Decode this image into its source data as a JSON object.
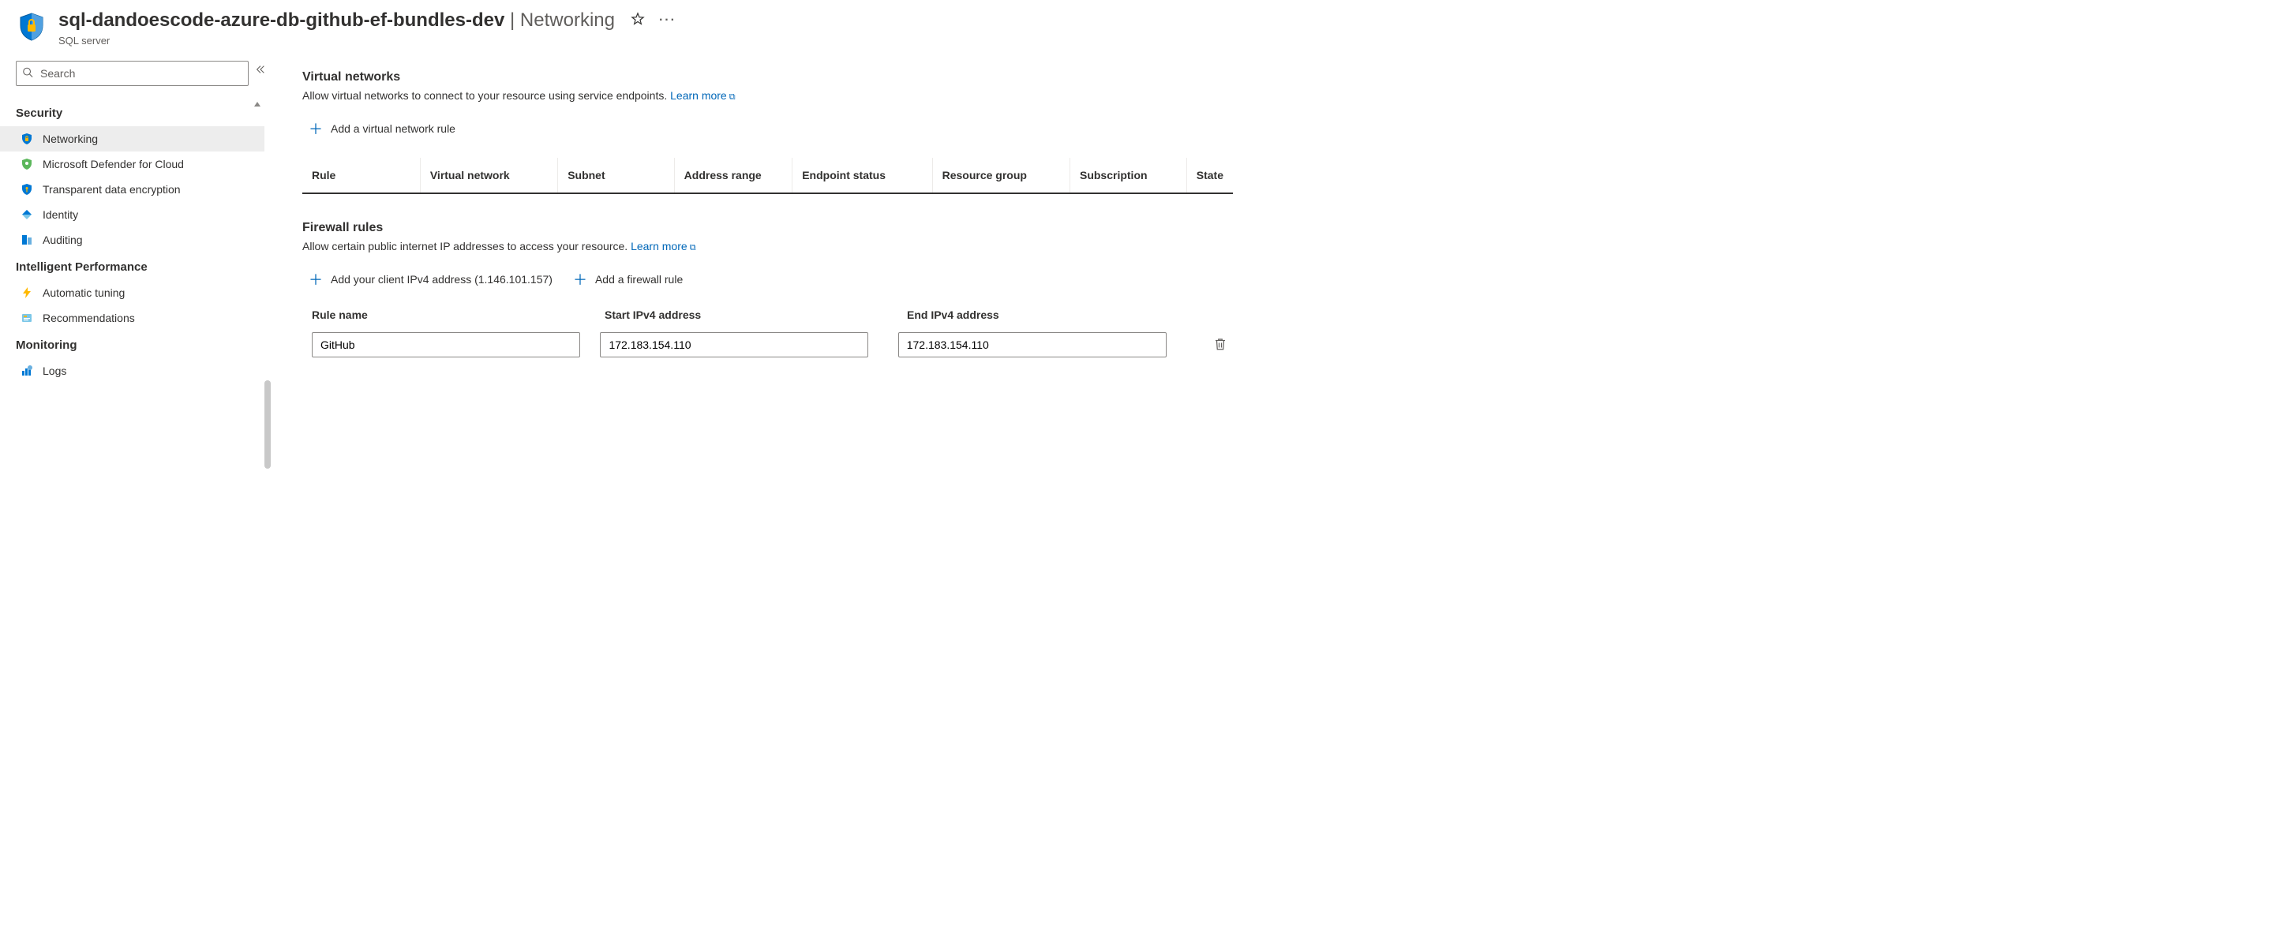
{
  "header": {
    "title": "sql-dandoescode-azure-db-github-ef-bundles-dev",
    "section": "Networking",
    "resource_type": "SQL server"
  },
  "sidebar": {
    "search_placeholder": "Search",
    "groups": [
      {
        "title": "Security",
        "items": [
          {
            "label": "Networking",
            "icon": "shield-lock-icon",
            "selected": true
          },
          {
            "label": "Microsoft Defender for Cloud",
            "icon": "defender-icon",
            "selected": false
          },
          {
            "label": "Transparent data encryption",
            "icon": "shield-key-icon",
            "selected": false
          },
          {
            "label": "Identity",
            "icon": "identity-icon",
            "selected": false
          },
          {
            "label": "Auditing",
            "icon": "auditing-icon",
            "selected": false
          }
        ]
      },
      {
        "title": "Intelligent Performance",
        "items": [
          {
            "label": "Automatic tuning",
            "icon": "lightning-icon",
            "selected": false
          },
          {
            "label": "Recommendations",
            "icon": "recommendations-icon",
            "selected": false
          }
        ]
      },
      {
        "title": "Monitoring",
        "items": [
          {
            "label": "Logs",
            "icon": "logs-icon",
            "selected": false
          }
        ]
      }
    ]
  },
  "main": {
    "vnet": {
      "title": "Virtual networks",
      "desc": "Allow virtual networks to connect to your resource using service endpoints.",
      "learn_more": "Learn more",
      "add_label": "Add a virtual network rule",
      "columns": [
        "Rule",
        "Virtual network",
        "Subnet",
        "Address range",
        "Endpoint status",
        "Resource group",
        "Subscription",
        "State"
      ]
    },
    "firewall": {
      "title": "Firewall rules",
      "desc": "Allow certain public internet IP addresses to access your resource.",
      "learn_more": "Learn more",
      "add_client_label": "Add your client IPv4 address (1.146.101.157)",
      "add_rule_label": "Add a firewall rule",
      "columns": [
        "Rule name",
        "Start IPv4 address",
        "End IPv4 address"
      ],
      "rules": [
        {
          "name": "GitHub",
          "start": "172.183.154.110",
          "end": "172.183.154.110"
        }
      ]
    }
  }
}
